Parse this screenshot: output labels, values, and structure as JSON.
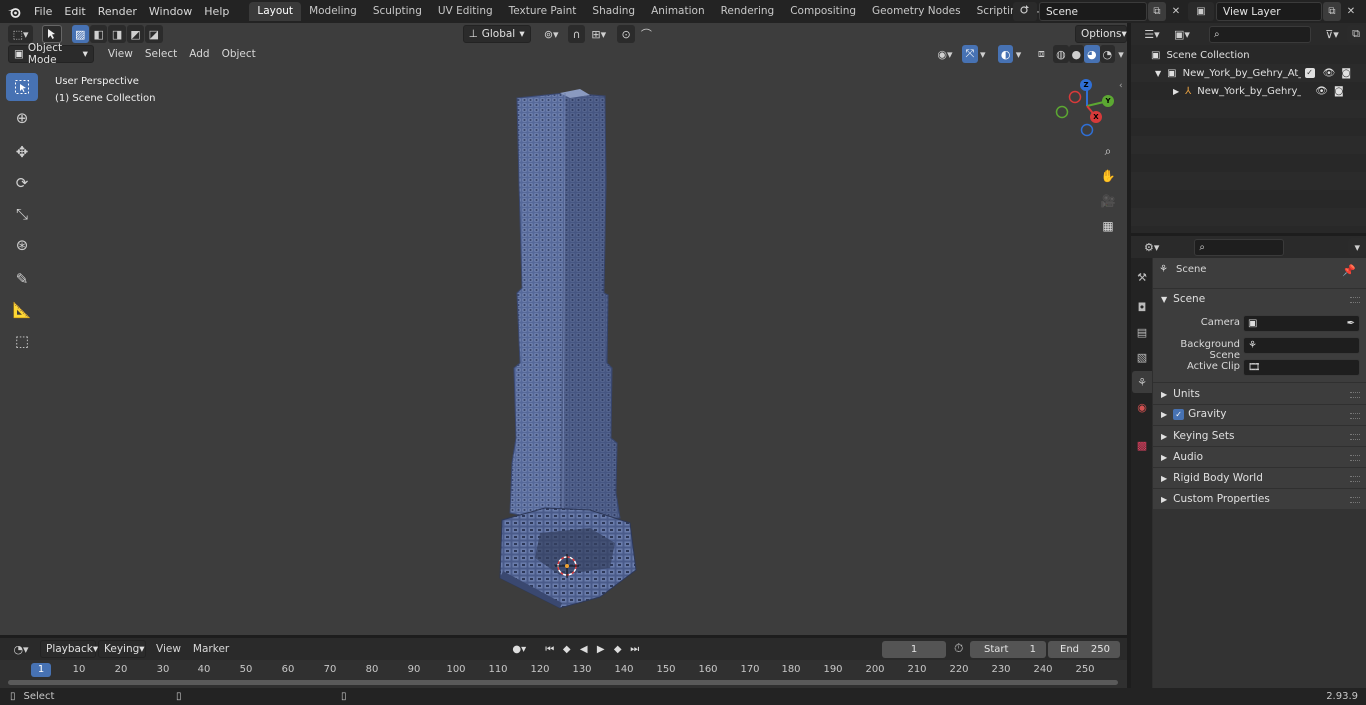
{
  "menu": {
    "items": [
      "File",
      "Edit",
      "Render",
      "Window",
      "Help"
    ]
  },
  "workspaces": {
    "tabs": [
      "Layout",
      "Modeling",
      "Sculpting",
      "UV Editing",
      "Texture Paint",
      "Shading",
      "Animation",
      "Rendering",
      "Compositing",
      "Geometry Nodes",
      "Scripting"
    ],
    "active": "Layout",
    "add": "+"
  },
  "scene_selector": {
    "value": "Scene"
  },
  "view_layer_selector": {
    "value": "View Layer"
  },
  "viewport": {
    "mode": "Object Mode",
    "menus": [
      "View",
      "Select",
      "Add",
      "Object"
    ],
    "transform_orientation": "Global",
    "options_label": "Options",
    "info_line1": "User Perspective",
    "info_line2": "(1) Scene Collection",
    "gizmo_axes": [
      "Z",
      "Y",
      "X"
    ]
  },
  "timeline": {
    "menus": [
      "Playback",
      "Keying",
      "View",
      "Marker"
    ],
    "current_frame": "1",
    "start_label": "Start",
    "start_value": "1",
    "end_label": "End",
    "end_value": "250",
    "ruler_ticks": [
      "1",
      "10",
      "20",
      "30",
      "40",
      "50",
      "60",
      "70",
      "80",
      "90",
      "100",
      "110",
      "120",
      "130",
      "140",
      "150",
      "160",
      "170",
      "180",
      "190",
      "200",
      "210",
      "220",
      "230",
      "240",
      "250"
    ]
  },
  "outliner": {
    "root": "Scene Collection",
    "items": [
      {
        "label": "New_York_by_Gehry_At_Nigh"
      },
      {
        "label": "New_York_by_Gehry_At_"
      }
    ]
  },
  "properties": {
    "context_title": "Scene",
    "panel_title": "Scene",
    "fields": [
      {
        "label": "Camera"
      },
      {
        "label": "Background Scene"
      },
      {
        "label": "Active Clip"
      }
    ],
    "sections": [
      "Units",
      "Gravity",
      "Keying Sets",
      "Audio",
      "Rigid Body World",
      "Custom Properties"
    ]
  },
  "statusbar": {
    "select_label": "Select",
    "version": "2.93.9"
  },
  "colors": {
    "accent": "#4772b3",
    "viewport_bg": "#3d3d3d",
    "building": "#5a6e98"
  }
}
